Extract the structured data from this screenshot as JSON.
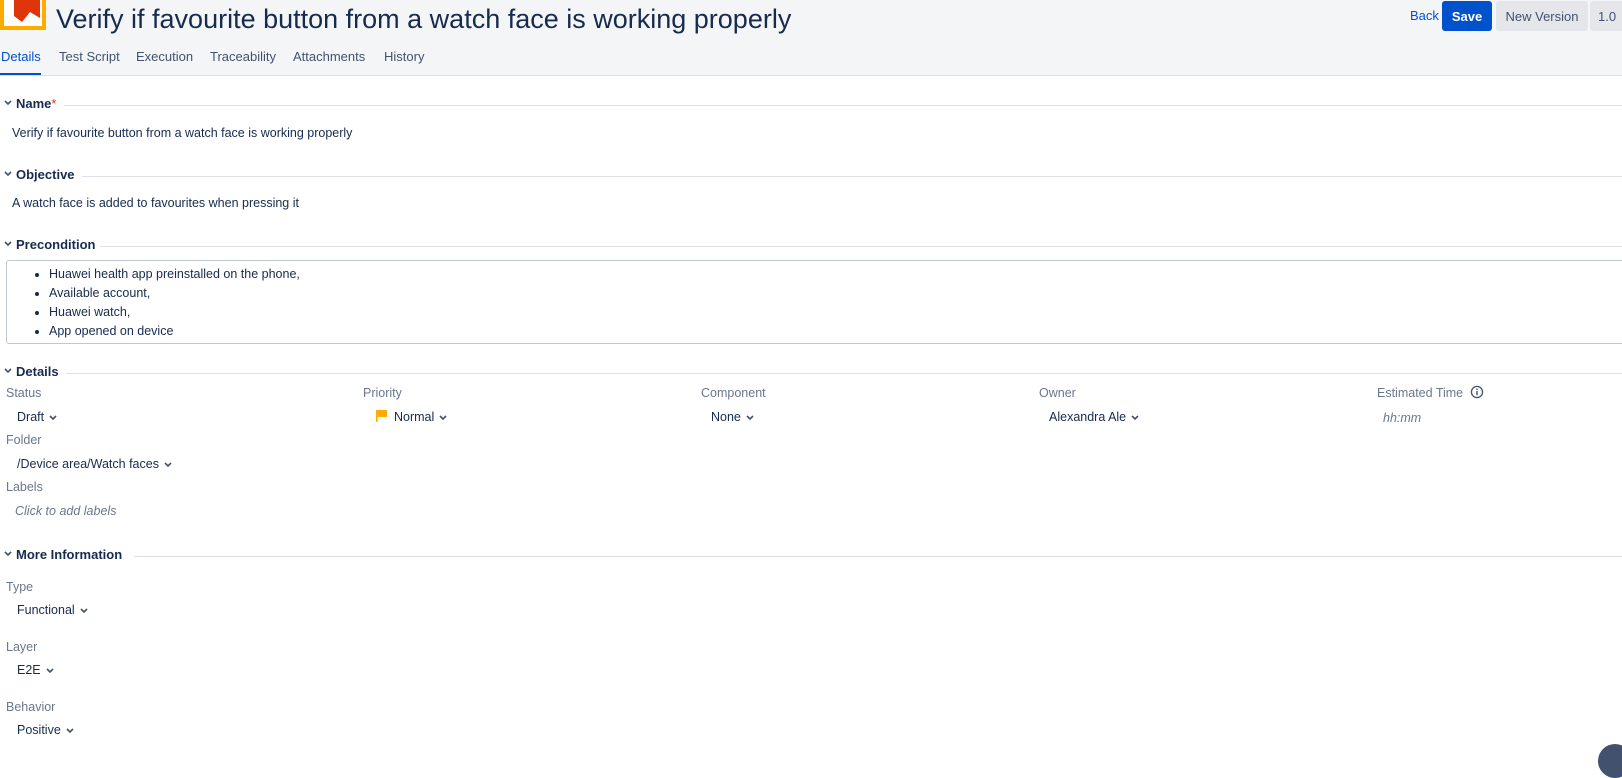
{
  "header": {
    "title": "Verify if favourite button from a watch face is working properly",
    "back_label": "Back",
    "save_label": "Save",
    "new_version_label": "New Version",
    "version_label": "1.0"
  },
  "tabs": [
    "Details",
    "Test Script",
    "Execution",
    "Traceability",
    "Attachments",
    "History"
  ],
  "active_tab": "Details",
  "sections": {
    "name": {
      "title": "Name",
      "required_mark": "*",
      "value": "Verify if favourite button from a watch face is working properly"
    },
    "objective": {
      "title": "Objective",
      "value": "A watch face is added to favourites when pressing it"
    },
    "precondition": {
      "title": "Precondition",
      "items": [
        "Huawei health app preinstalled on the phone,",
        "Available account,",
        "Huawei watch,",
        "App opened on device"
      ]
    },
    "details": {
      "title": "Details",
      "status": {
        "label": "Status",
        "value": "Draft"
      },
      "priority": {
        "label": "Priority",
        "value": "Normal"
      },
      "component": {
        "label": "Component",
        "value": "None"
      },
      "owner": {
        "label": "Owner",
        "value": "Alexandra Ale"
      },
      "estimated_time": {
        "label": "Estimated Time",
        "placeholder": "hh:mm"
      },
      "folder": {
        "label": "Folder",
        "value": "/Device area/Watch faces"
      },
      "labels": {
        "label": "Labels",
        "placeholder": "Click to add labels"
      }
    },
    "more_info": {
      "title": "More Information",
      "type": {
        "label": "Type",
        "value": "Functional"
      },
      "layer": {
        "label": "Layer",
        "value": "E2E"
      },
      "behavior": {
        "label": "Behavior",
        "value": "Positive"
      }
    }
  },
  "colors": {
    "accent": "#0052cc",
    "text": "#172b4d",
    "muted": "#6b778c",
    "priority_flag": "#ffab00",
    "app_icon_red": "#de350b",
    "app_icon_yellow": "#ffab00"
  }
}
